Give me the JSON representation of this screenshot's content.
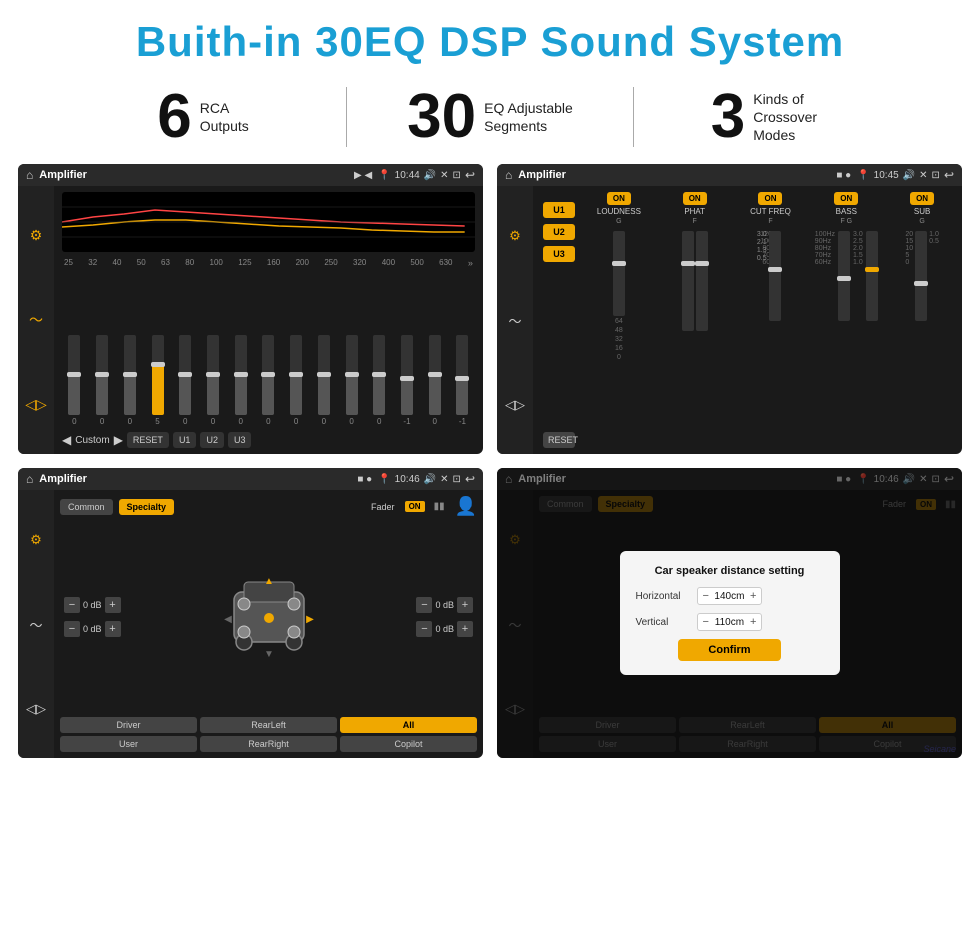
{
  "header": {
    "title": "Buith-in 30EQ DSP Sound System"
  },
  "stats": [
    {
      "number": "6",
      "desc_line1": "RCA",
      "desc_line2": "Outputs"
    },
    {
      "number": "30",
      "desc_line1": "EQ Adjustable",
      "desc_line2": "Segments"
    },
    {
      "number": "3",
      "desc_line1": "Kinds of",
      "desc_line2": "Crossover Modes"
    }
  ],
  "screen1": {
    "title": "Amplifier",
    "time": "10:44",
    "tab_label": "Custom",
    "bottom_buttons": [
      "RESET",
      "U1",
      "U2",
      "U3"
    ],
    "eq_freqs": [
      "25",
      "32",
      "40",
      "50",
      "63",
      "80",
      "100",
      "125",
      "160",
      "200",
      "250",
      "320",
      "400",
      "500",
      "630"
    ],
    "eq_values": [
      "0",
      "0",
      "0",
      "5",
      "0",
      "0",
      "0",
      "0",
      "0",
      "0",
      "0",
      "0",
      "-1",
      "0",
      "-1"
    ]
  },
  "screen2": {
    "title": "Amplifier",
    "time": "10:45",
    "presets": [
      "U1",
      "U2",
      "U3"
    ],
    "channels": [
      "LOUDNESS",
      "PHAT",
      "CUT FREQ",
      "BASS",
      "SUB"
    ],
    "reset_label": "RESET"
  },
  "screen3": {
    "title": "Amplifier",
    "time": "10:46",
    "tabs": [
      "Common",
      "Specialty"
    ],
    "fader_label": "Fader",
    "fader_on": "ON",
    "positions": [
      "Driver",
      "RearLeft",
      "All",
      "User",
      "RearRight",
      "Copilot"
    ],
    "db_values": [
      "0 dB",
      "0 dB",
      "0 dB",
      "0 dB"
    ]
  },
  "screen4": {
    "title": "Amplifier",
    "time": "10:46",
    "tabs": [
      "Common",
      "Specialty"
    ],
    "dialog": {
      "title": "Car speaker distance setting",
      "horizontal_label": "Horizontal",
      "horizontal_value": "140cm",
      "vertical_label": "Vertical",
      "vertical_value": "110cm",
      "confirm_label": "Confirm"
    },
    "positions": [
      "Driver",
      "RearLeft",
      "All",
      "User",
      "RearRight",
      "Copilot"
    ],
    "db_values": [
      "0 dB",
      "0 dB"
    ]
  },
  "seicane": "Seicane"
}
